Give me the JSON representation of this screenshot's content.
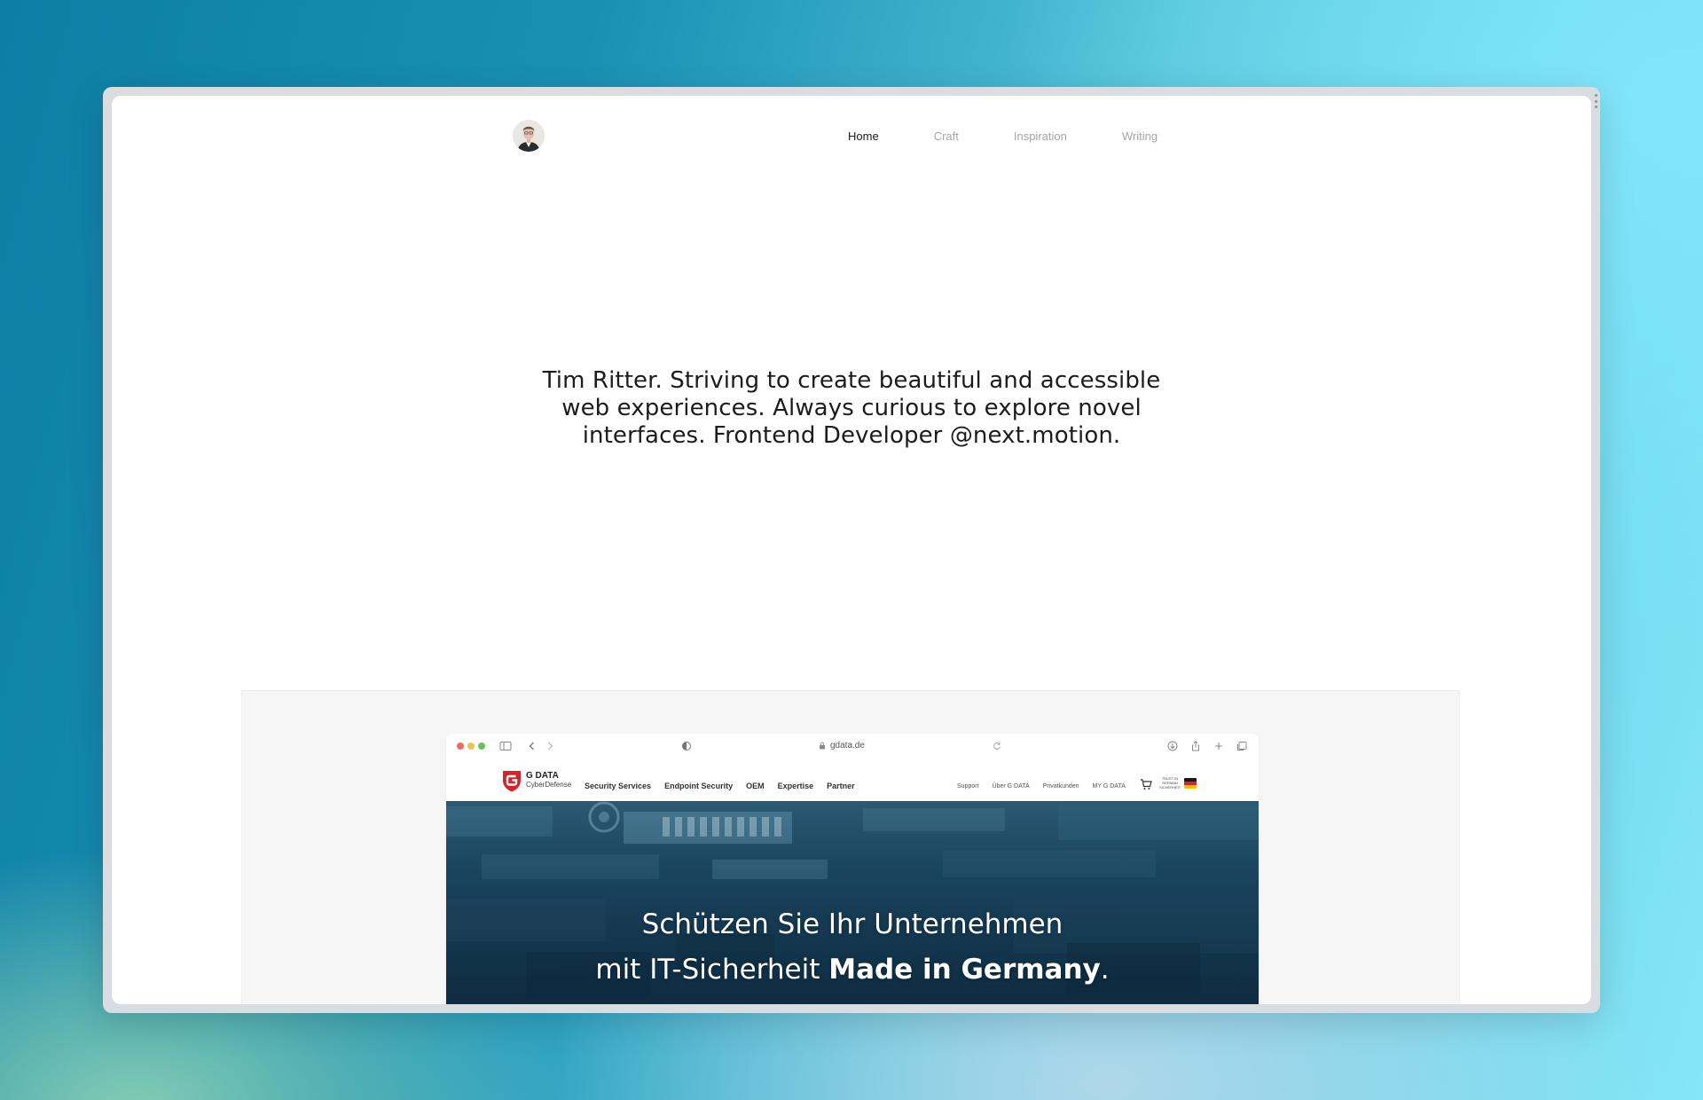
{
  "nav": {
    "items": [
      {
        "label": "Home",
        "active": true
      },
      {
        "label": "Craft",
        "active": false
      },
      {
        "label": "Inspiration",
        "active": false
      },
      {
        "label": "Writing",
        "active": false
      }
    ]
  },
  "intro": {
    "text": "Tim Ritter. Striving to create beautiful and accessible web experiences. Always curious to explore novel interfaces. Frontend Developer @next.motion."
  },
  "showcase": {
    "browser": {
      "url": "gdata.de",
      "icons": [
        "sidebar-icon",
        "back-icon",
        "forward-icon",
        "shield-icon",
        "reload-icon",
        "download-icon",
        "share-icon",
        "new-tab-icon",
        "tabs-icon"
      ]
    },
    "site": {
      "logo_title": "G DATA",
      "logo_subtitle": "CyberDefense",
      "primary_nav": [
        "Security Services",
        "Endpoint Security",
        "OEM",
        "Expertise",
        "Partner"
      ],
      "secondary_nav": [
        "Support",
        "Über G DATA",
        "Privatkunden",
        "MY G DATA"
      ],
      "trust_badge": "TRUST IN GERMAN SICHERHEIT",
      "hero_line1": "Schützen Sie Ihr Unternehmen",
      "hero_line2_prefix": "mit IT-Sicherheit ",
      "hero_line2_bold": "Made in Germany",
      "hero_line2_suffix": "."
    }
  },
  "colors": {
    "traffic_red": "#ee6a5f",
    "traffic_yellow": "#f5bf4f",
    "traffic_green": "#62c554",
    "gdata_red": "#d8232a",
    "nav_active": "#1a1a1a",
    "nav_inactive": "#a6a6a6"
  }
}
